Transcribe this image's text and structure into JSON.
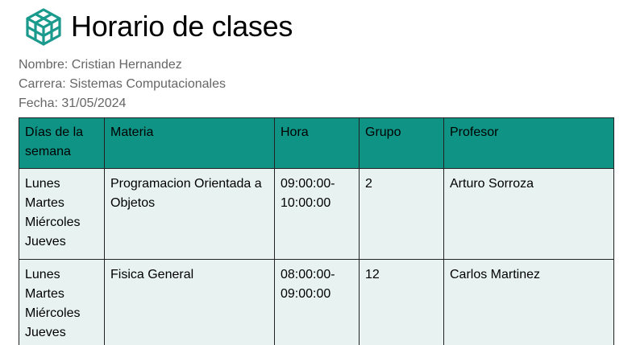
{
  "header": {
    "logo_icon": "cube-grid-icon",
    "title": "Horario de clases"
  },
  "info": {
    "nombre": "Nombre: Cristian Hernandez",
    "carrera": "Carrera: Sistemas Computacionales",
    "fecha": "Fecha: 31/05/2024"
  },
  "colors": {
    "accent": "#0f9385",
    "row_bg": "#e8f3f1",
    "info_text": "#666666"
  },
  "table": {
    "headers": [
      "Días de la semana",
      "Materia",
      "Hora",
      "Grupo",
      "Profesor"
    ],
    "rows": [
      {
        "dias": [
          "Lunes",
          "Martes",
          "Miércoles",
          "Jueves"
        ],
        "materia": "Programacion Orientada a Objetos",
        "hora": "09:00:00-10:00:00",
        "grupo": "2",
        "profesor": "Arturo Sorroza"
      },
      {
        "dias": [
          "Lunes",
          "Martes",
          "Miércoles",
          "Jueves"
        ],
        "materia": "Fisica General",
        "hora": "08:00:00-09:00:00",
        "grupo": "12",
        "profesor": "Carlos Martinez"
      }
    ]
  }
}
